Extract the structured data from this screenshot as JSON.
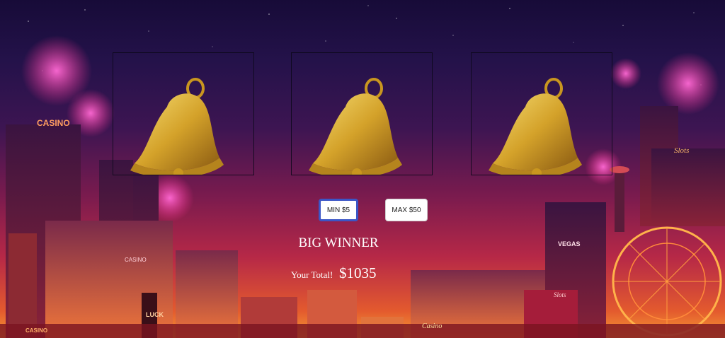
{
  "reels": [
    {
      "symbol": "bell-icon"
    },
    {
      "symbol": "bell-icon"
    },
    {
      "symbol": "bell-icon"
    }
  ],
  "buttons": {
    "min_label": "MIN $5",
    "max_label": "MAX $50"
  },
  "result": {
    "message": "BIG WINNER",
    "total_label": "Your Total!",
    "total_value": "$1035"
  },
  "background": {
    "signs": [
      "CASINO",
      "Slots",
      "CASINO",
      "VEGAS",
      "Slots",
      "Casino",
      "LUCK",
      "CASINO"
    ]
  },
  "colors": {
    "min_border": "#3b56c6",
    "bell_gold": "#d4a22a"
  }
}
